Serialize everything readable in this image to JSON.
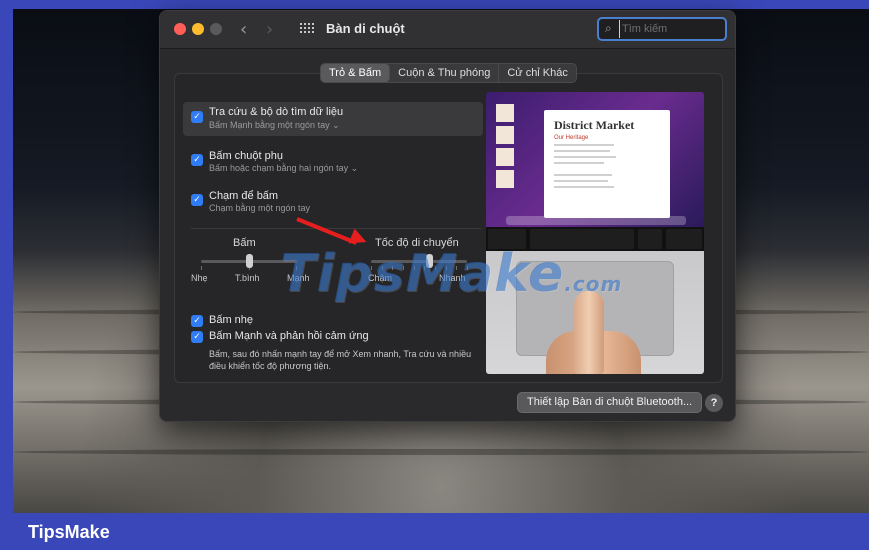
{
  "window": {
    "title": "Bàn di chuột",
    "search_placeholder": "Tìm kiếm"
  },
  "tabs": [
    {
      "label": "Trỏ & Bấm",
      "active": true
    },
    {
      "label": "Cuộn & Thu phóng",
      "active": false
    },
    {
      "label": "Cử chỉ Khác",
      "active": false
    }
  ],
  "options": [
    {
      "label": "Tra cứu & bộ dò tìm dữ liệu",
      "sub": "Bấm Mạnh bằng một ngón tay ⌄",
      "checked": true
    },
    {
      "label": "Bấm chuột phụ",
      "sub": "Bấm hoặc chạm bằng hai ngón tay ⌄",
      "checked": true
    },
    {
      "label": "Chạm để bấm",
      "sub": "Chạm bằng một ngón tay",
      "checked": true
    }
  ],
  "click_slider": {
    "title": "Bấm",
    "labels": [
      "Nhẹ",
      "T.bình",
      "Mạnh"
    ],
    "value_index": 1
  },
  "speed_slider": {
    "title": "Tốc độ di chuyển",
    "min_label": "Chậm",
    "max_label": "Nhanh",
    "value_fraction": 0.6
  },
  "bottom_options": [
    {
      "label": "Bấm nhẹ",
      "checked": true
    },
    {
      "label": "Bấm Mạnh và phản hồi cảm ứng",
      "checked": true
    }
  ],
  "force_desc": "Bấm, sau đó nhấn mạnh tay để mở Xem nhanh, Tra cứu và nhiều điều khiển tốc độ phương tiện.",
  "preview": {
    "doc_title": "District Market",
    "doc_heading": "Our Heritage"
  },
  "bluetooth_button": "Thiết lập Bàn di chuột Bluetooth...",
  "help_button": "?",
  "watermark": "TipsMake",
  "watermark_suffix": ".com",
  "footer_brand": "TipsMake",
  "colors": {
    "accent": "#2f7cf6",
    "annotation_arrow": "#e61e1e",
    "brand_bar": "#3a47b8"
  }
}
